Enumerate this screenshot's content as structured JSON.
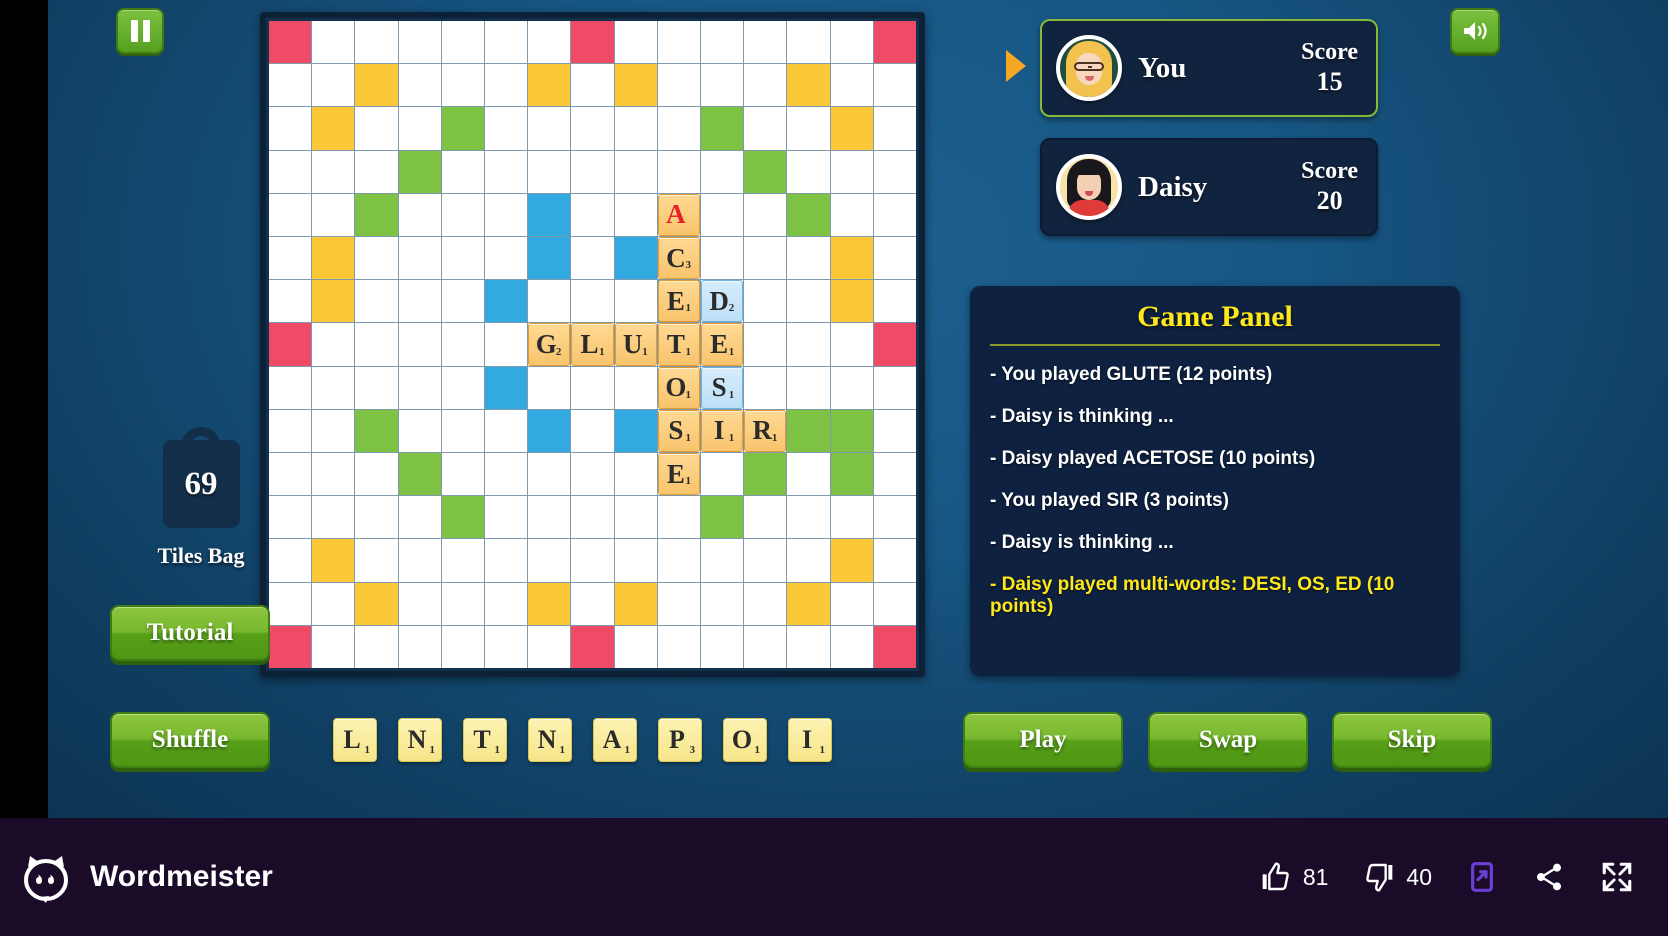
{
  "app": {
    "brand_name": "Wordmeister",
    "logo_icon": "cat-speech-logo-icon"
  },
  "topbar": {
    "pause_icon": "pause-icon",
    "sound_icon": "speaker-on-icon"
  },
  "bag": {
    "count": "69",
    "label": "Tiles Bag",
    "icon": "bag-icon"
  },
  "buttons": {
    "tutorial": "Tutorial",
    "shuffle": "Shuffle",
    "play": "Play",
    "swap": "Swap",
    "skip": "Skip"
  },
  "players": [
    {
      "name": "You",
      "score_label": "Score",
      "score": "15",
      "active": true,
      "avatar": "avatar-blonde-glasses",
      "turn_icon": "turn-arrow-icon"
    },
    {
      "name": "Daisy",
      "score_label": "Score",
      "score": "20",
      "active": false,
      "avatar": "avatar-dark-hair-red"
    }
  ],
  "game_panel": {
    "title": "Game Panel",
    "log": [
      {
        "text": "- You played GLUTE (12 points)",
        "highlight": false
      },
      {
        "text": "- Daisy is thinking ...",
        "highlight": false
      },
      {
        "text": "- Daisy played ACETOSE (10 points)",
        "highlight": false
      },
      {
        "text": "- You played SIR (3 points)",
        "highlight": false
      },
      {
        "text": "- Daisy is thinking ...",
        "highlight": false
      },
      {
        "text": "- Daisy played multi-words: DESI, OS, ED (10 points)",
        "highlight": true
      }
    ]
  },
  "rack": [
    {
      "letter": "L",
      "points": "1"
    },
    {
      "letter": "N",
      "points": "1"
    },
    {
      "letter": "T",
      "points": "1"
    },
    {
      "letter": "N",
      "points": "1"
    },
    {
      "letter": "A",
      "points": "1"
    },
    {
      "letter": "P",
      "points": "3"
    },
    {
      "letter": "O",
      "points": "1"
    },
    {
      "letter": "I",
      "points": "1"
    }
  ],
  "board": {
    "size": 15,
    "premium": {
      "tw": [
        [
          0,
          0
        ],
        [
          0,
          7
        ],
        [
          0,
          14
        ],
        [
          7,
          0
        ],
        [
          7,
          14
        ],
        [
          14,
          0
        ],
        [
          14,
          7
        ],
        [
          14,
          14
        ]
      ],
      "dw": [
        [
          1,
          2
        ],
        [
          1,
          6
        ],
        [
          1,
          8
        ],
        [
          1,
          12
        ],
        [
          2,
          1
        ],
        [
          2,
          13
        ],
        [
          5,
          1
        ],
        [
          5,
          13
        ],
        [
          6,
          1
        ],
        [
          6,
          13
        ],
        [
          12,
          1
        ],
        [
          12,
          13
        ],
        [
          13,
          2
        ],
        [
          13,
          12
        ],
        [
          13,
          6
        ],
        [
          13,
          8
        ]
      ],
      "tl": [
        [
          2,
          4
        ],
        [
          2,
          10
        ],
        [
          3,
          3
        ],
        [
          3,
          11
        ],
        [
          4,
          2
        ],
        [
          4,
          12
        ],
        [
          9,
          2
        ],
        [
          9,
          12
        ],
        [
          10,
          3
        ],
        [
          10,
          11
        ],
        [
          11,
          4
        ],
        [
          11,
          10
        ],
        [
          10,
          13
        ],
        [
          9,
          13
        ]
      ],
      "dl": [
        [
          5,
          6
        ],
        [
          5,
          8
        ],
        [
          6,
          5
        ],
        [
          8,
          5
        ],
        [
          9,
          6
        ],
        [
          9,
          8
        ],
        [
          4,
          6
        ],
        [
          6,
          9
        ]
      ]
    },
    "tiles": [
      {
        "row": 4,
        "col": 9,
        "letter": "A",
        "points": "",
        "state": "blank-red"
      },
      {
        "row": 5,
        "col": 9,
        "letter": "C",
        "points": "3",
        "state": "normal"
      },
      {
        "row": 6,
        "col": 9,
        "letter": "E",
        "points": "1",
        "state": "normal"
      },
      {
        "row": 6,
        "col": 10,
        "letter": "D",
        "points": "2",
        "state": "recent"
      },
      {
        "row": 7,
        "col": 6,
        "letter": "G",
        "points": "2",
        "state": "normal"
      },
      {
        "row": 7,
        "col": 7,
        "letter": "L",
        "points": "1",
        "state": "normal"
      },
      {
        "row": 7,
        "col": 8,
        "letter": "U",
        "points": "1",
        "state": "normal"
      },
      {
        "row": 7,
        "col": 9,
        "letter": "T",
        "points": "1",
        "state": "normal"
      },
      {
        "row": 7,
        "col": 10,
        "letter": "E",
        "points": "1",
        "state": "normal"
      },
      {
        "row": 8,
        "col": 9,
        "letter": "O",
        "points": "1",
        "state": "normal"
      },
      {
        "row": 8,
        "col": 10,
        "letter": "S",
        "points": "1",
        "state": "recent"
      },
      {
        "row": 9,
        "col": 9,
        "letter": "S",
        "points": "1",
        "state": "normal"
      },
      {
        "row": 9,
        "col": 10,
        "letter": "I",
        "points": "1",
        "state": "normal"
      },
      {
        "row": 9,
        "col": 11,
        "letter": "R",
        "points": "1",
        "state": "normal"
      },
      {
        "row": 10,
        "col": 9,
        "letter": "E",
        "points": "1",
        "state": "normal"
      }
    ]
  },
  "bottombar": {
    "likes": "81",
    "dislikes": "40",
    "like_icon": "thumbs-up-icon",
    "dislike_icon": "thumbs-down-icon",
    "open_icon": "open-in-new-icon",
    "share_icon": "share-icon",
    "fullscreen_icon": "fullscreen-icon"
  },
  "colors": {
    "triple_word": "#ef4b66",
    "double_word": "#fcc838",
    "triple_letter": "#7dc242",
    "double_letter": "#32a9e0",
    "accent_green": "#8dc63f",
    "panel_yellow": "#ffe81a"
  }
}
